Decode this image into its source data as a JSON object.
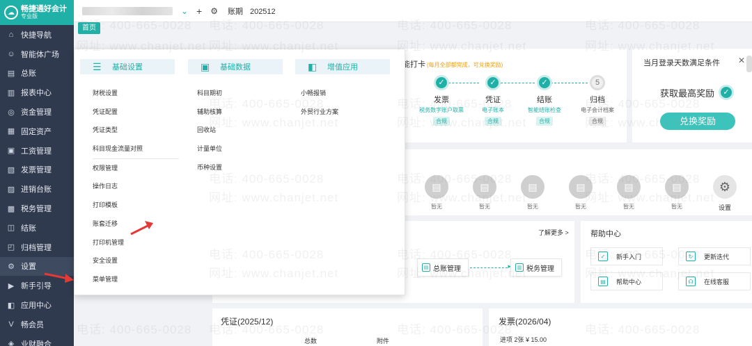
{
  "brand": {
    "app_name": "畅捷通好会计",
    "edition": "专业版"
  },
  "sidebar": {
    "items": [
      {
        "label": "快捷导航",
        "icon": "home-icon"
      },
      {
        "label": "智能体广场",
        "icon": "robot-icon"
      },
      {
        "label": "总账",
        "icon": "ledger-icon"
      },
      {
        "label": "报表中心",
        "icon": "chart-icon"
      },
      {
        "label": "资金管理",
        "icon": "money-icon"
      },
      {
        "label": "固定资产",
        "icon": "building-icon"
      },
      {
        "label": "工资管理",
        "icon": "salary-icon"
      },
      {
        "label": "发票管理",
        "icon": "invoice-icon"
      },
      {
        "label": "进销台账",
        "icon": "inventory-icon"
      },
      {
        "label": "税务管理",
        "icon": "tax-icon"
      },
      {
        "label": "结账",
        "icon": "close-books-icon"
      },
      {
        "label": "归档管理",
        "icon": "archive-icon"
      },
      {
        "label": "设置",
        "icon": "gear-icon"
      },
      {
        "label": "新手引导",
        "icon": "play-icon"
      },
      {
        "label": "应用中心",
        "icon": "apps-icon"
      },
      {
        "label": "畅会员",
        "icon": "vip-icon"
      },
      {
        "label": "业财融合",
        "icon": "link-icon"
      }
    ]
  },
  "topbar": {
    "period_label": "账期",
    "period_value": "202512"
  },
  "tabs": {
    "home": "首页"
  },
  "checkin": {
    "title": "能打卡",
    "note": "(每月全部都完成，可兑换奖励)",
    "steps": [
      {
        "icon": "✓",
        "name": "发票",
        "sub": "税务数字账户取票",
        "badge": "合规"
      },
      {
        "icon": "✓",
        "name": "凭证",
        "sub": "电子账本",
        "badge": "合规"
      },
      {
        "icon": "✓",
        "name": "结账",
        "sub": "智能结账检查",
        "badge": "合规"
      },
      {
        "icon": "5",
        "name": "归档",
        "sub": "电子会计档案",
        "badge": "合规"
      }
    ]
  },
  "reward": {
    "title": "当月登录天数满足条件",
    "status": "获取最高奖励",
    "button": "兑换奖励"
  },
  "shortcuts": {
    "empty_label": "暂无",
    "settings_label": "设置"
  },
  "flow": {
    "learn_more": "了解更多 >",
    "box1": "总账管理",
    "box2": "税务管理"
  },
  "help": {
    "title": "帮助中心",
    "items": [
      "新手入门",
      "更新迭代",
      "帮助中心",
      "在线客服"
    ]
  },
  "voucher": {
    "title": "凭证(2025/12)",
    "col_total": "总数",
    "col_attach": "附件"
  },
  "invoice": {
    "title": "发票(2026/04)",
    "line": "进项  2张  ¥ 15.00"
  },
  "menu": {
    "categories": [
      "基础设置",
      "基础数据",
      "增值应用"
    ],
    "basic_settings": [
      "财税设置",
      "凭证配置",
      "凭证类型",
      "科目现金流量对照",
      "权限管理",
      "操作日志",
      "打印模板",
      "账套迁移",
      "打印机管理",
      "安全设置",
      "菜单管理"
    ],
    "basic_data": [
      "科目期初",
      "辅助核算",
      "回收站",
      "计量单位",
      "币种设置"
    ],
    "value_added": [
      "小畅报销",
      "外贸行业方案"
    ]
  },
  "watermark": {
    "phone": "电话: 400-665-0028",
    "site": "网址: www.chanjet.net"
  },
  "colors": {
    "accent": "#1fb1a8",
    "sidebar_bg": "#2f3a4e",
    "annotation_arrow": "#e53935"
  }
}
